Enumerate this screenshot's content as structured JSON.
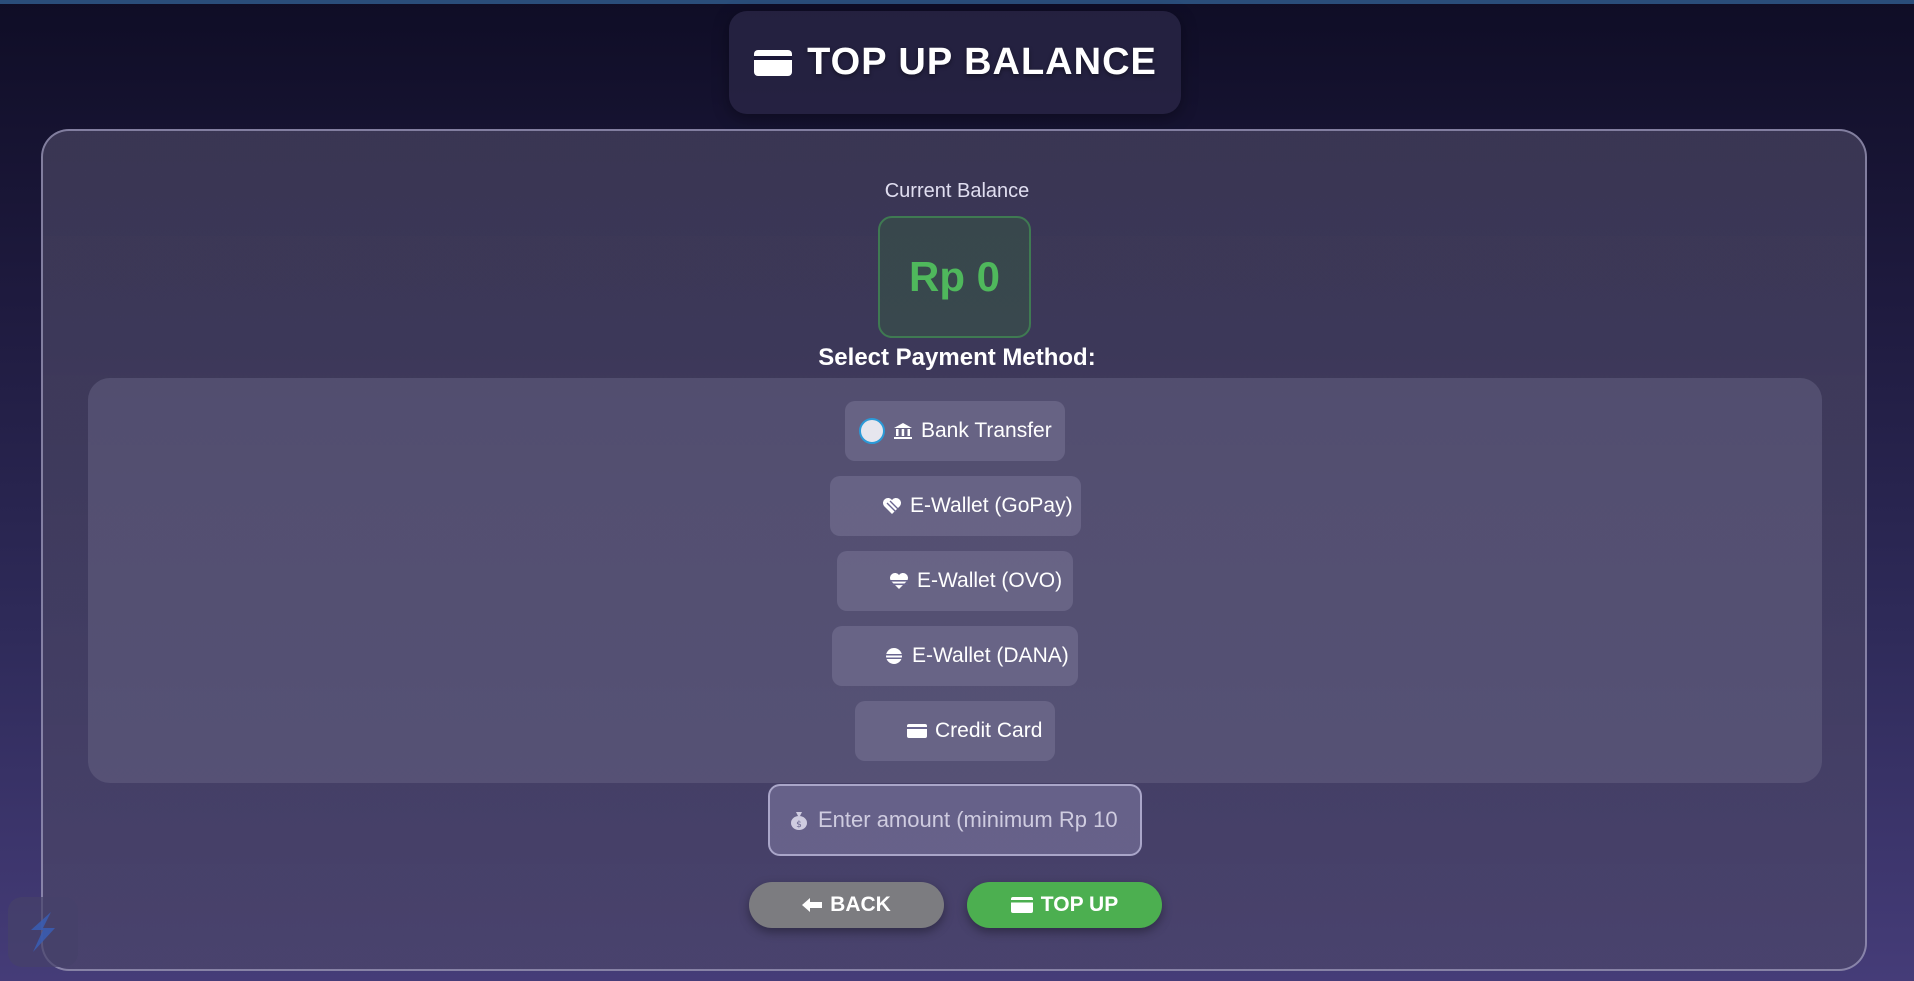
{
  "header": {
    "title": "TOP UP BALANCE",
    "icon": "credit-card-icon"
  },
  "balance": {
    "label": "Current Balance",
    "value": "Rp 0"
  },
  "payment": {
    "label": "Select Payment Method:",
    "methods": [
      {
        "icon": "bank-icon",
        "label": "Bank Transfer",
        "selected": false
      },
      {
        "icon": "heart-icon",
        "label": "E-Wallet (GoPay)"
      },
      {
        "icon": "heart-icon",
        "label": "E-Wallet (OVO)"
      },
      {
        "icon": "coin-icon",
        "label": "E-Wallet (DANA)"
      },
      {
        "icon": "credit-card-icon",
        "label": "Credit Card"
      }
    ]
  },
  "amount": {
    "icon": "money-bag-icon",
    "placeholder": "Enter amount (minimum Rp 10",
    "value": ""
  },
  "buttons": {
    "back_label": "BACK",
    "topup_label": "TOP UP"
  },
  "colors": {
    "accent_green": "#4caf50",
    "balance_green": "#4fb85c",
    "back_gray": "#7c7c80",
    "radio_border": "#2b9ad8"
  }
}
